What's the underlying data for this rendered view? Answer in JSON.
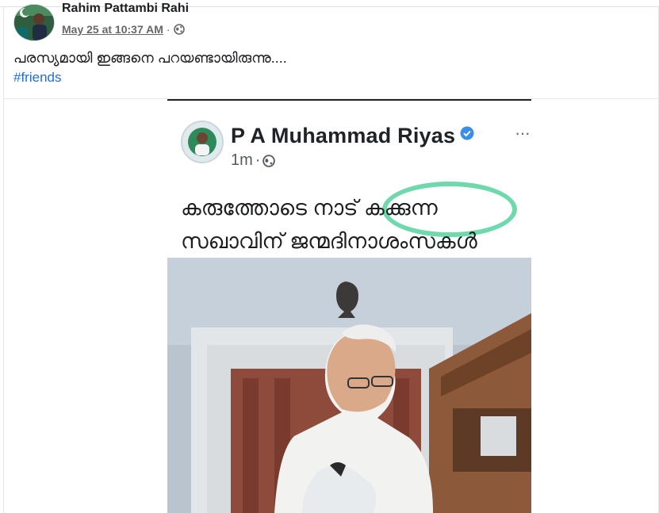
{
  "post": {
    "author": "Rahim Pattambi Rahi",
    "timestamp": "May 25 at 10:37 AM",
    "separator": "·",
    "privacy_icon": "globe-icon",
    "text": "പരസ്യമായി ഇങ്ങനെ പറയണ്ടായിരുന്നു....",
    "hashtag": "#friends"
  },
  "shared_screenshot": {
    "name": "P A Muhammad Riyas",
    "verified_icon": "verified-badge-icon",
    "time": "1m",
    "separator": "·",
    "more": "···",
    "line1": "കരുത്തോടെ നാട് കക്കുന്ന",
    "line2": "സഖാവിന് ജന്മദിനാശംസകൾ",
    "highlight_color": "#5fd4a4"
  },
  "colors": {
    "link": "#216fdb",
    "text": "#1c1e21",
    "secondary": "#65676b"
  }
}
